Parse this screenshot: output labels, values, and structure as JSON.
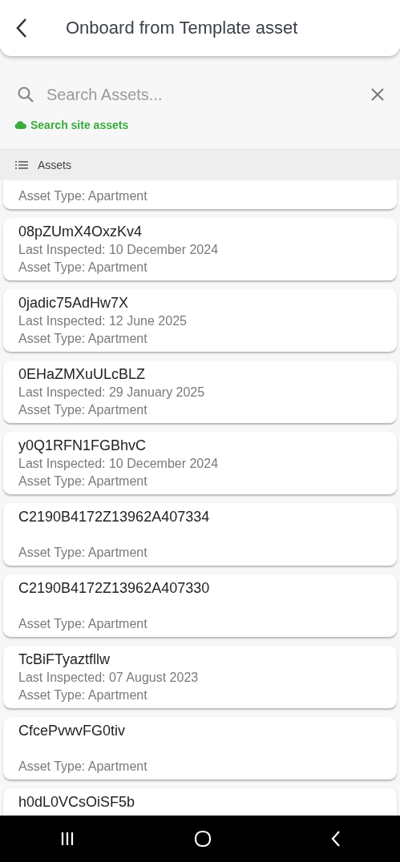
{
  "header": {
    "title": "Onboard from Template asset"
  },
  "search": {
    "placeholder": "Search Assets...",
    "site_link": "Search site assets"
  },
  "section": {
    "title": "Assets"
  },
  "assets": [
    {
      "asset_type": "Asset Type: Apartment"
    },
    {
      "name": "08pZUmX4OxzKv4",
      "last_inspected": "Last Inspected: 10 December 2024",
      "asset_type": "Asset Type: Apartment"
    },
    {
      "name": "0jadic75AdHw7X",
      "last_inspected": "Last Inspected: 12 June 2025",
      "asset_type": "Asset Type: Apartment"
    },
    {
      "name": "0EHaZMXuULcBLZ",
      "last_inspected": "Last Inspected: 29 January 2025",
      "asset_type": "Asset Type: Apartment"
    },
    {
      "name": "y0Q1RFN1FGBhvC",
      "last_inspected": "Last Inspected: 10 December 2024",
      "asset_type": "Asset Type: Apartment"
    },
    {
      "name": "C2190B4172Z13962A407334",
      "asset_type": "Asset Type: Apartment"
    },
    {
      "name": "C2190B4172Z13962A407330",
      "asset_type": "Asset Type: Apartment"
    },
    {
      "name": "TcBiFTyaztfllw",
      "last_inspected": "Last Inspected: 07 August 2023",
      "asset_type": "Asset Type: Apartment"
    },
    {
      "name": "CfcePvwvFG0tiv",
      "asset_type": "Asset Type: Apartment"
    },
    {
      "name": "h0dL0VCsOiSF5b"
    }
  ]
}
